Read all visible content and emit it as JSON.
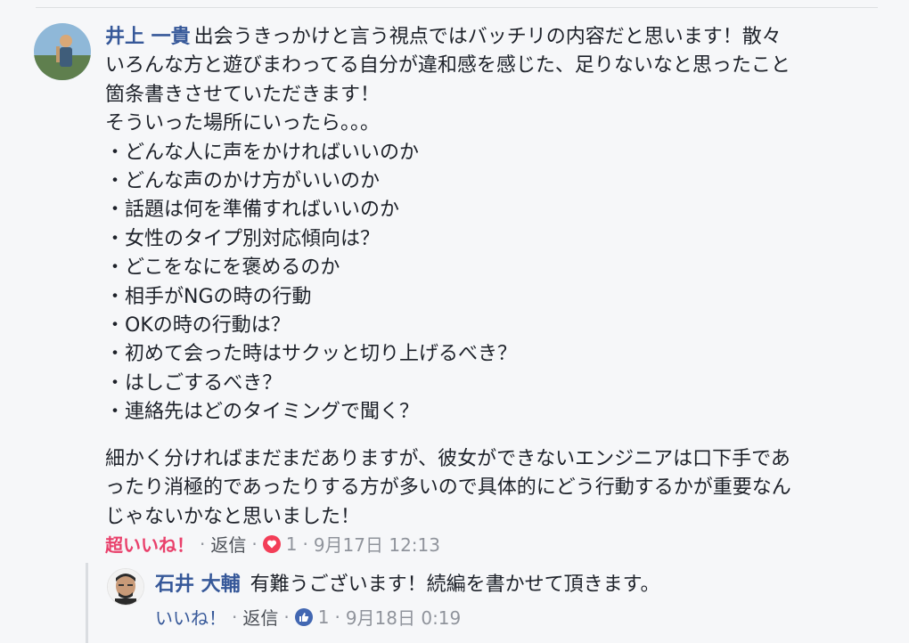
{
  "comment": {
    "author": "井上 一貴",
    "lines": [
      "出会うきっかけと言う視点ではバッチリの内容だと思います！散々",
      "いろんな方と遊びまわってる自分が違和感を感じた、足りないなと思ったこと",
      "箇条書きさせていただきます！",
      "そういった場所にいったら。。。",
      "・どんな人に声をかければいいのか",
      "・どんな声のかけ方がいいのか",
      "・話題は何を準備すればいいのか",
      "・女性のタイプ別対応傾向は？",
      "・どこをなにを褒めるのか",
      "・相手がNGの時の行動",
      "・OKの時の行動は？",
      "・初めて会った時はサクッと切り上げるべき？",
      "・はしごするべき？",
      "・連絡先はどのタイミングで聞く？"
    ],
    "paragraph2": [
      "細かく分ければまだまだありますが、彼女ができないエンジニアは口下手であ",
      "ったり消極的であったりする方が多いので具体的にどう行動するかが重要なん",
      "じゃないかなと思いました！"
    ],
    "reaction_label": "超いいね！",
    "separator": "·",
    "reply_label": "返信",
    "reaction_count": "1",
    "date": "9月17日 12:13",
    "reaction_icon": "heart-icon",
    "reaction_color": "#f33e58"
  },
  "reply": {
    "author": "石井 大輔",
    "text": "有難うございます！続編を書かせて頂きます。",
    "like_label": "いいね！",
    "reply_label": "返信",
    "separator": "·",
    "reaction_count": "1",
    "date": "9月18日 0:19",
    "reaction_icon": "like-thumb-icon",
    "reaction_color": "#4267b2"
  },
  "colors": {
    "author": "#365899",
    "super_like": "#e9406b",
    "background": "#f6f7f9"
  }
}
